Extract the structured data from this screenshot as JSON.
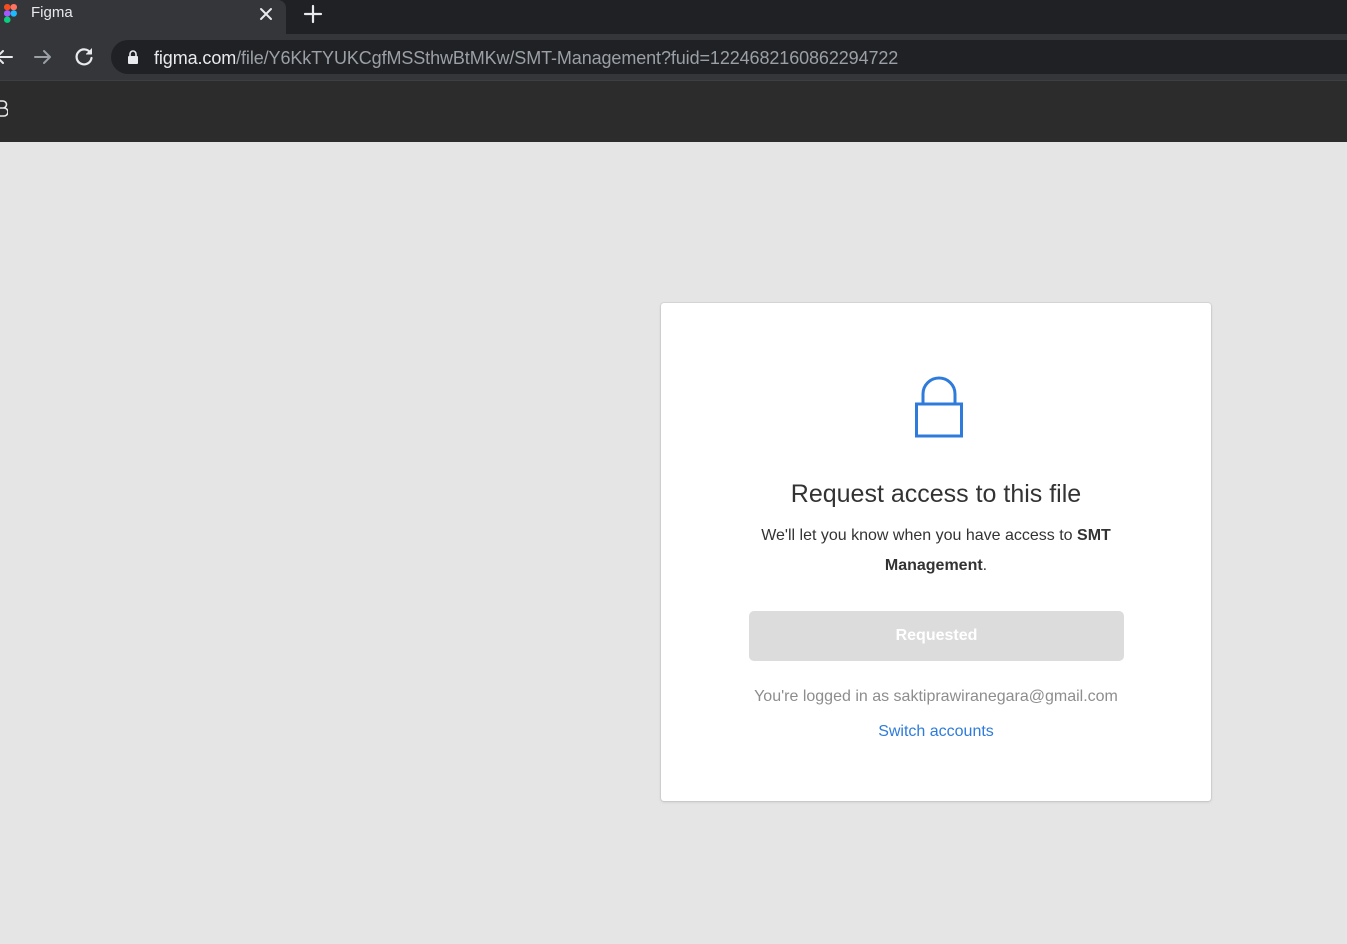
{
  "browser": {
    "tab_title": "Figma",
    "url_host": "figma.com",
    "url_rest": "/file/Y6KkTYUKCgfMSSthwBtMKw/SMT-Management?fuid=1224682160862294722"
  },
  "card": {
    "title": "Request access to this file",
    "desc_prefix": "We'll let you know when you have access to ",
    "file_name": "SMT Management",
    "desc_suffix": ".",
    "button_label": "Requested",
    "logged_in_text": "You're logged in as saktiprawiranegara@gmail.com",
    "switch_label": "Switch accounts"
  },
  "colors": {
    "accent": "#2e7bdb",
    "button_disabled": "#dcdcdc",
    "page_bg": "#e5e5e5"
  }
}
